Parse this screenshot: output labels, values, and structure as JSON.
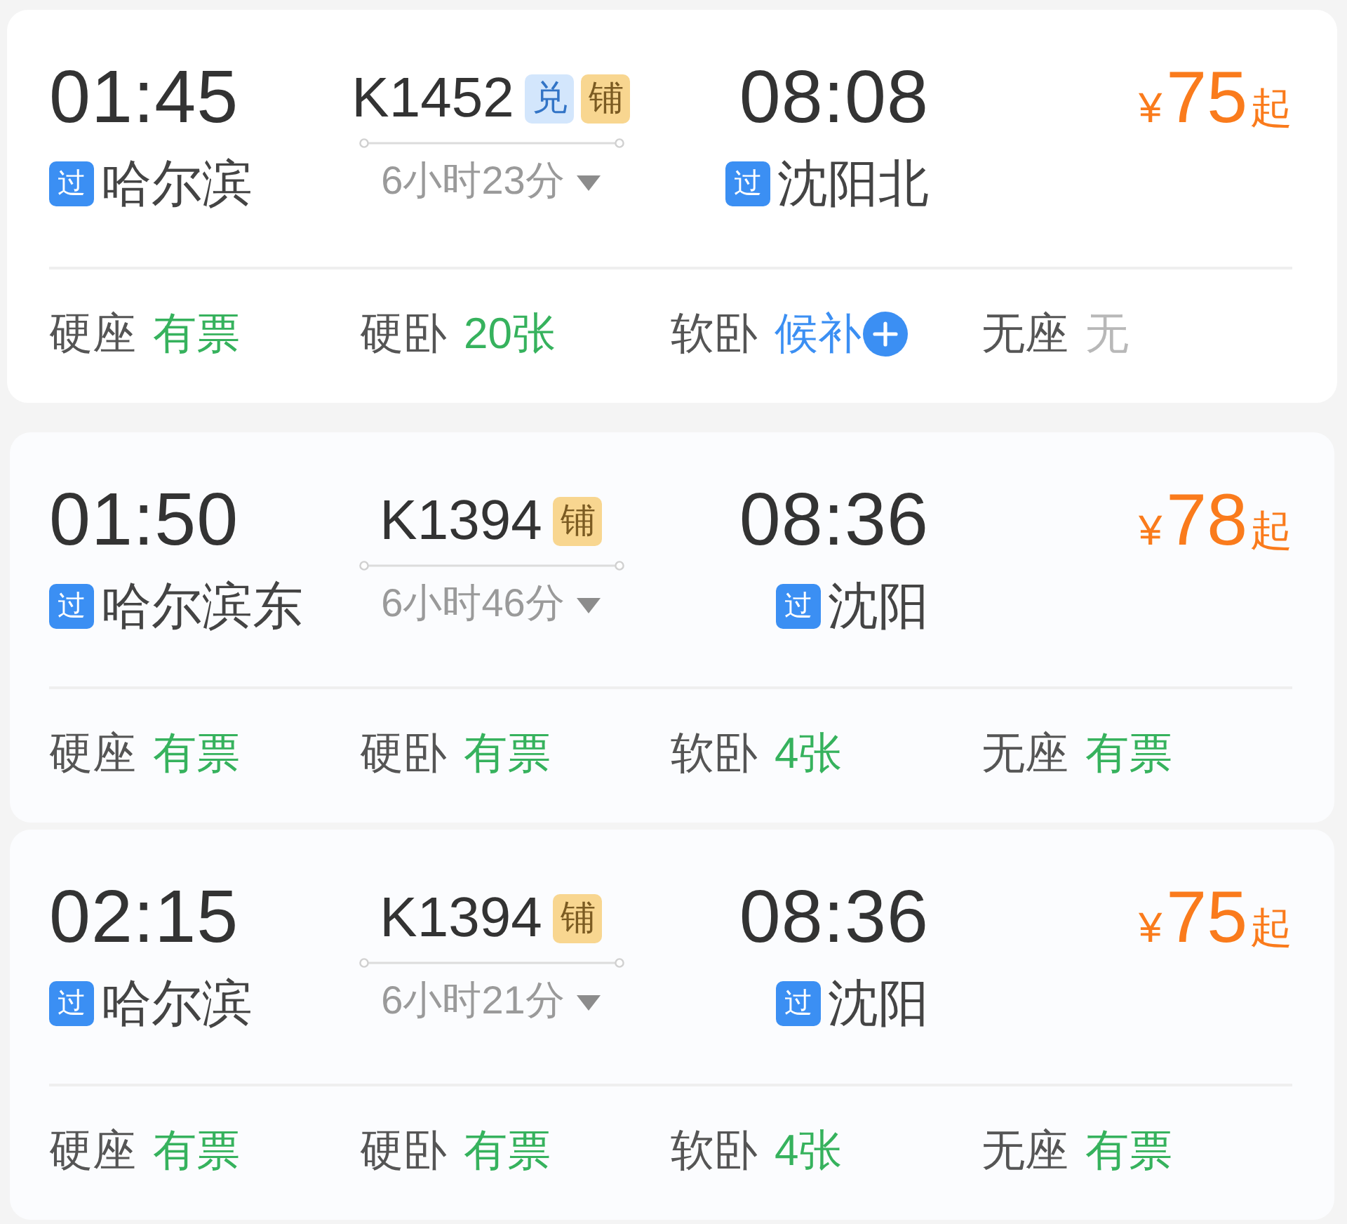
{
  "trains": [
    {
      "departure": {
        "time": "01:45",
        "tag": "过",
        "station": "哈尔滨"
      },
      "train_no": "K1452",
      "badges": [
        {
          "text": "兑",
          "kind": "exchange"
        },
        {
          "text": "铺",
          "kind": "berth"
        }
      ],
      "duration": "6小时23分",
      "arrival": {
        "time": "08:08",
        "tag": "过",
        "station": "沈阳北"
      },
      "price": {
        "currency": "¥",
        "amount": "75",
        "suffix": "起"
      },
      "seats": [
        {
          "class": "硬座",
          "availability": "有票",
          "kind": "available"
        },
        {
          "class": "硬卧",
          "availability": "20张",
          "kind": "available"
        },
        {
          "class": "软卧",
          "availability": "候补",
          "kind": "waitlist"
        },
        {
          "class": "无座",
          "availability": "无",
          "kind": "none"
        }
      ]
    },
    {
      "departure": {
        "time": "01:50",
        "tag": "过",
        "station": "哈尔滨东"
      },
      "train_no": "K1394",
      "badges": [
        {
          "text": "铺",
          "kind": "berth"
        }
      ],
      "duration": "6小时46分",
      "arrival": {
        "time": "08:36",
        "tag": "过",
        "station": "沈阳"
      },
      "price": {
        "currency": "¥",
        "amount": "78",
        "suffix": "起"
      },
      "seats": [
        {
          "class": "硬座",
          "availability": "有票",
          "kind": "available"
        },
        {
          "class": "硬卧",
          "availability": "有票",
          "kind": "available"
        },
        {
          "class": "软卧",
          "availability": "4张",
          "kind": "available"
        },
        {
          "class": "无座",
          "availability": "有票",
          "kind": "available"
        }
      ]
    },
    {
      "departure": {
        "time": "02:15",
        "tag": "过",
        "station": "哈尔滨"
      },
      "train_no": "K1394",
      "badges": [
        {
          "text": "铺",
          "kind": "berth"
        }
      ],
      "duration": "6小时21分",
      "arrival": {
        "time": "08:36",
        "tag": "过",
        "station": "沈阳"
      },
      "price": {
        "currency": "¥",
        "amount": "75",
        "suffix": "起"
      },
      "seats": [
        {
          "class": "硬座",
          "availability": "有票",
          "kind": "available"
        },
        {
          "class": "硬卧",
          "availability": "有票",
          "kind": "available"
        },
        {
          "class": "软卧",
          "availability": "4张",
          "kind": "available"
        },
        {
          "class": "无座",
          "availability": "有票",
          "kind": "available"
        }
      ]
    }
  ]
}
